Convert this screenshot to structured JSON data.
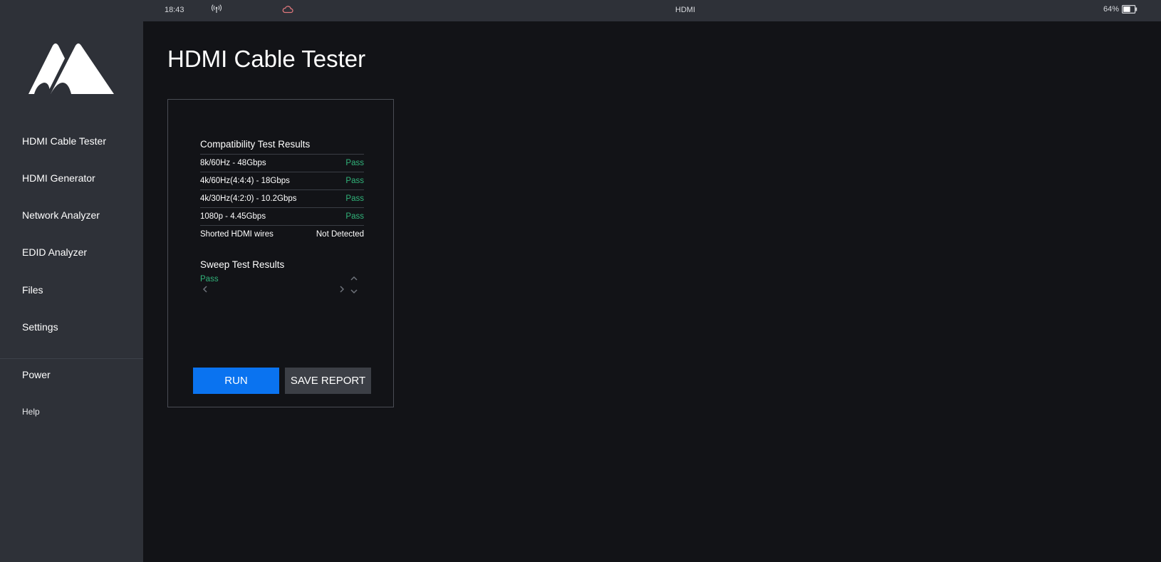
{
  "status_bar": {
    "time": "18:43",
    "title": "HDMI",
    "battery_percent": "64%",
    "antenna_icon": "antenna-icon",
    "cloud_icon": "cloud-icon",
    "battery_icon": "battery-icon",
    "battery_level": 0.64
  },
  "sidebar": {
    "logo_icon": "brand-logo",
    "items": [
      {
        "label": "HDMI Cable Tester"
      },
      {
        "label": "HDMI Generator"
      },
      {
        "label": "Network Analyzer"
      },
      {
        "label": "EDID Analyzer"
      },
      {
        "label": "Files"
      },
      {
        "label": "Settings"
      }
    ],
    "power_label": "Power",
    "help_label": "Help"
  },
  "main": {
    "title": "HDMI Cable Tester",
    "compatibility": {
      "title": "Compatibility Test Results",
      "rows": [
        {
          "label": "8k/60Hz - 48Gbps",
          "value": "Pass"
        },
        {
          "label": "4k/60Hz(4:4:4) - 18Gbps",
          "value": "Pass"
        },
        {
          "label": "4k/30Hz(4:2:0) - 10.2Gbps",
          "value": "Pass"
        },
        {
          "label": "1080p - 4.45Gbps",
          "value": "Pass"
        },
        {
          "label": "Shorted HDMI wires",
          "value": "Not Detected"
        }
      ]
    },
    "sweep": {
      "title": "Sweep Test Results",
      "result": "Pass"
    },
    "buttons": {
      "run": "RUN",
      "save_report": "SAVE REPORT"
    }
  },
  "colors": {
    "accent": "#0a73f0",
    "pass": "#31b37a",
    "sidebar_bg": "#2e3138",
    "main_bg": "#121317"
  }
}
